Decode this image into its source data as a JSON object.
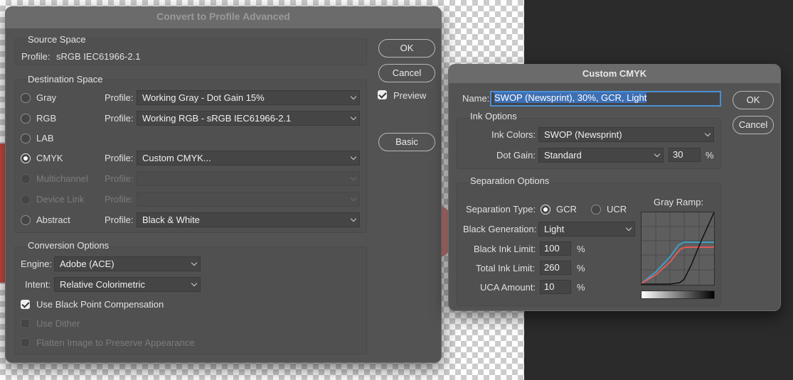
{
  "convert_dialog": {
    "title": "Convert to Profile Advanced",
    "source_space": {
      "legend": "Source Space",
      "profile_label": "Profile:",
      "profile_value": "sRGB IEC61966-2.1"
    },
    "destination_space": {
      "legend": "Destination Space",
      "profile_label": "Profile:",
      "rows": [
        {
          "label": "Gray",
          "profile": "Working Gray - Dot Gain 15%"
        },
        {
          "label": "RGB",
          "profile": "Working RGB - sRGB IEC61966-2.1"
        },
        {
          "label": "LAB",
          "profile": ""
        },
        {
          "label": "CMYK",
          "profile": "Custom CMYK..."
        },
        {
          "label": "Multichannel",
          "profile": ""
        },
        {
          "label": "Device Link",
          "profile": ""
        },
        {
          "label": "Abstract",
          "profile": "Black & White"
        }
      ],
      "selected": "CMYK"
    },
    "conversion_options": {
      "legend": "Conversion Options",
      "engine_label": "Engine:",
      "engine_value": "Adobe (ACE)",
      "intent_label": "Intent:",
      "intent_value": "Relative Colorimetric",
      "black_point_label": "Use Black Point Compensation",
      "black_point_checked": true,
      "dither_label": "Use Dither",
      "flatten_label": "Flatten Image to Preserve Appearance"
    },
    "buttons": {
      "ok": "OK",
      "cancel": "Cancel",
      "basic": "Basic"
    },
    "preview_label": "Preview",
    "preview_checked": true
  },
  "cmyk_dialog": {
    "title": "Custom CMYK",
    "name_label": "Name:",
    "name_value": "SWOP (Newsprint), 30%, GCR, Light",
    "ink_options": {
      "legend": "Ink Options",
      "ink_colors_label": "Ink Colors:",
      "ink_colors_value": "SWOP (Newsprint)",
      "dot_gain_label": "Dot Gain:",
      "dot_gain_value": "Standard",
      "dot_gain_amount": "30",
      "percent": "%"
    },
    "separation_options": {
      "legend": "Separation Options",
      "type_label": "Separation Type:",
      "gcr_label": "GCR",
      "ucr_label": "UCR",
      "selected_type": "GCR",
      "black_gen_label": "Black Generation:",
      "black_gen_value": "Light",
      "black_ink_limit_label": "Black Ink Limit:",
      "black_ink_limit_value": "100",
      "total_ink_limit_label": "Total Ink Limit:",
      "total_ink_limit_value": "260",
      "uca_amount_label": "UCA Amount:",
      "uca_amount_value": "10",
      "percent": "%",
      "gray_ramp_label": "Gray Ramp:",
      "curve_colors": {
        "cyan": "#3ea0c8",
        "red": "#e05a5a",
        "black": "#111111"
      }
    },
    "buttons": {
      "ok": "OK",
      "cancel": "Cancel"
    }
  }
}
